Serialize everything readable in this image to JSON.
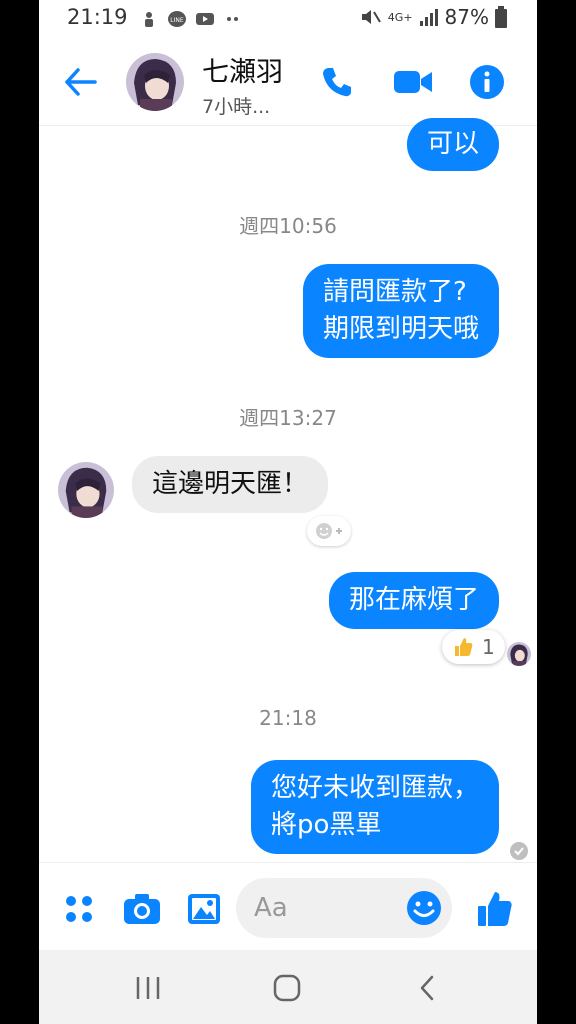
{
  "status_bar": {
    "time": "21:19",
    "network": "4G+",
    "battery": "87%"
  },
  "header": {
    "contact_name": "七瀬羽",
    "contact_status": "7小時...",
    "accent_color": "#0b84ff"
  },
  "messages": [
    {
      "type": "outgoing",
      "text": "可以"
    },
    {
      "type": "timestamp",
      "text": "週四10:56"
    },
    {
      "type": "outgoing",
      "lines": [
        "請問匯款了?",
        "期限到明天哦"
      ]
    },
    {
      "type": "timestamp",
      "text": "週四13:27"
    },
    {
      "type": "incoming",
      "text": "這邊明天匯！"
    },
    {
      "type": "outgoing",
      "text": "那在麻煩了",
      "reaction": {
        "emoji": "thumbs-up-icon",
        "count": "1"
      }
    },
    {
      "type": "timestamp",
      "text": "21:18"
    },
    {
      "type": "outgoing",
      "lines": [
        "您好未收到匯款，",
        "將po黑單"
      ]
    }
  ],
  "composer": {
    "placeholder": "Aa"
  },
  "icons": {
    "status_left": [
      "teams-icon",
      "line-icon",
      "youtube-icon",
      "more-dots-icon"
    ],
    "status_right": [
      "mute-icon",
      "signal-icon",
      "battery-icon"
    ],
    "header": [
      "back-arrow-icon",
      "phone-icon",
      "video-icon",
      "info-icon"
    ],
    "composer": [
      "menu-dots-icon",
      "camera-icon",
      "image-icon",
      "emoji-icon",
      "thumbs-up-icon"
    ],
    "nav": [
      "recents-icon",
      "home-icon",
      "back-icon"
    ]
  }
}
